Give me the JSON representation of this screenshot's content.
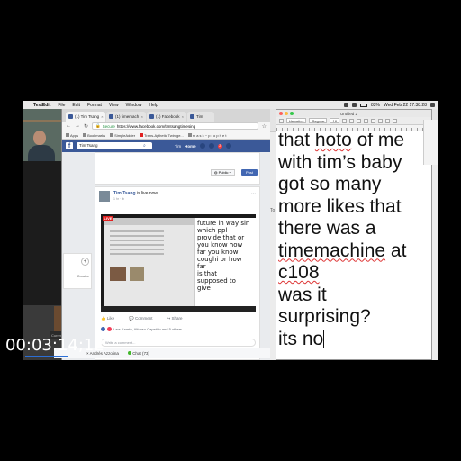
{
  "menubar": {
    "app": "TextEdit",
    "items": [
      "File",
      "Edit",
      "Format",
      "View",
      "Window",
      "Help"
    ],
    "clock": "Wed Feb 22 17:38:28",
    "battery": "83%"
  },
  "browser": {
    "tabs": [
      {
        "label": "(1) Tim Tsang"
      },
      {
        "label": "(1) timemach"
      },
      {
        "label": "(1) Facebook"
      },
      {
        "label": "Tim"
      }
    ],
    "url_secure_label": "Secure",
    "url": "https://www.facebook.com/timtsangtimesing",
    "bookmarks": [
      "Apps",
      "Bookmarks",
      "SimpleAdder",
      "Trans-Aythetic Twin ge...",
      "m a s k ~ p r o p h e t"
    ]
  },
  "facebook": {
    "search_value": "Tim Tsang",
    "user": "Tim",
    "home": "Home",
    "notif_count": "2",
    "public_label": "Public",
    "post_button": "Post",
    "post": {
      "author": "Tim Tsang",
      "status": "is live now.",
      "time": "1 hr · ⊕"
    },
    "video_text": [
      "future in way sin",
      "which ppl",
      "provide that or",
      "you know how",
      "far you know",
      "coughi or how",
      "far",
      "is that",
      "supposed to",
      "give"
    ],
    "live_badge": "LIVE",
    "actions": [
      "Like",
      "Comment",
      "Share"
    ],
    "reactions": "Lars Kaarto, Alfonso Capetillo and 5 others",
    "comment_placeholder": "Write a comment...",
    "left_card_label": "Curator",
    "chat_user": "Andrés Azzolina",
    "chat_label": "Chat (73)"
  },
  "left": {
    "current_call": "Current Call"
  },
  "textedit": {
    "window_title": "Untitled 2",
    "toolbar": {
      "style": "Helvetica",
      "weight": "Regular",
      "size": "18"
    },
    "lines": [
      {
        "pre": "that ",
        "sq": "hoto",
        "post": " of me"
      },
      {
        "pre": "with tim’s baby",
        "sq": "",
        "post": ""
      },
      {
        "pre": "got so many",
        "sq": "",
        "post": ""
      },
      {
        "pre": "more likes that",
        "sq": "",
        "post": ""
      },
      {
        "pre": "there was a",
        "sq": "",
        "post": ""
      },
      {
        "pre": "",
        "sq": "timemachine",
        "post": " at"
      },
      {
        "pre": "",
        "sq": "c108",
        "post": ""
      },
      {
        "pre": "was it",
        "sq": "",
        "post": ""
      },
      {
        "pre": "surprising?",
        "sq": "",
        "post": ""
      },
      {
        "pre": "its no",
        "sq": "",
        "post": ""
      }
    ],
    "back_partial": "To"
  },
  "timecode": "00:03:14;12"
}
